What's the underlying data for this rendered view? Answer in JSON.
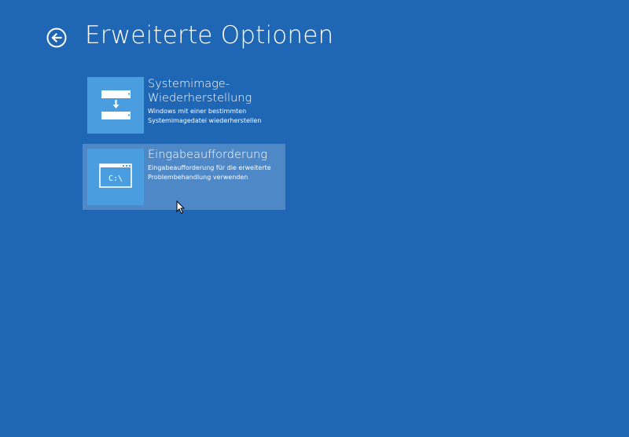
{
  "header": {
    "title": "Erweiterte Optionen",
    "back_icon": "back-arrow-circle-icon"
  },
  "options": [
    {
      "title_line1": "Systemimage-",
      "title_line2": "Wiederherstellung",
      "desc_line1": "Windows mit einer bestimmten",
      "desc_line2": "Systemimagedatei wiederherstellen",
      "icon": "system-image-recovery-icon",
      "selected": false
    },
    {
      "title_line1": "Eingabeaufforderung",
      "desc_line1": "Eingabeaufforderung für die erweiterte",
      "desc_line2": "Problembehandlung verwenden",
      "icon": "command-prompt-icon",
      "icon_text": "C:\\",
      "selected": true
    }
  ],
  "colors": {
    "background": "#1f66b5",
    "tile": "#4a9ee0",
    "selected_highlight": "#4f88c6"
  }
}
